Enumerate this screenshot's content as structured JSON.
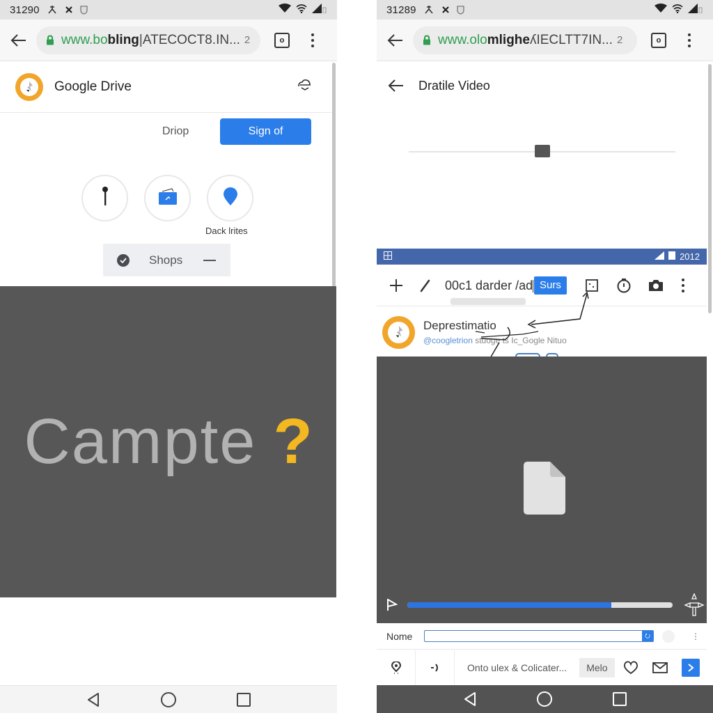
{
  "left": {
    "status": {
      "time": "31290",
      "icons": [
        "fan-icon",
        "close-icon",
        "shield-icon"
      ],
      "right_icons": [
        "wifi-icon",
        "wifi-icon",
        "signal-icon"
      ]
    },
    "url": {
      "prefix": "www.bo",
      "bold": "bling",
      "rest": "|ATECOCT8.IN...",
      "tab_count": "2",
      "tabs_label": "o"
    },
    "header": {
      "title": "Google Drive",
      "logo": "google-drive-logo",
      "action_icon": "cloud-icon"
    },
    "actions": {
      "drop_label": "Driop",
      "sign_label": "Sign of"
    },
    "round_buttons": [
      {
        "icon": "pin-icon",
        "label": ""
      },
      {
        "icon": "folder-icon",
        "label": ""
      },
      {
        "icon": "location-icon",
        "label": "Dack lrites"
      }
    ],
    "chip": {
      "label": "Shops",
      "icon": "check-circle-icon"
    },
    "hero": {
      "text": "Campte",
      "mark": "?"
    },
    "nav": [
      "back",
      "home",
      "recents"
    ]
  },
  "right": {
    "status": {
      "time": "31289",
      "icons": [
        "fan-icon",
        "close-icon",
        "shield-icon"
      ],
      "right_icons": [
        "wifi-icon",
        "wifi-icon",
        "signal-icon"
      ]
    },
    "url": {
      "prefix": "www.olo",
      "bold": "mlighe",
      "rest": "ʎIECLTT7IN...",
      "tab_count": "2",
      "tabs_label": "o"
    },
    "header": {
      "title": "Dratile Video"
    },
    "slider": {
      "value": 0.5
    },
    "bluebar": {
      "year": "2012"
    },
    "toolbar": {
      "field_value": "00c1 darder /ad",
      "button_label": "Surs"
    },
    "profile": {
      "name": "Deprestimatio",
      "handle": "@coogletrion",
      "handle_rest": " stuoge ts Ic_Gogle Nituo"
    },
    "video": {
      "progress": 0.77
    },
    "name_row": {
      "label": "Nome",
      "value": "",
      "addon": "⭮"
    },
    "action_row": {
      "text": "Onto ulex & Colicater...",
      "button_label": "Melo"
    },
    "nav": [
      "back",
      "home",
      "recents"
    ]
  },
  "colors": {
    "accent": "#2b7de9",
    "logo_orange": "#f1a52a",
    "hero_bg": "#575757",
    "hero_mark": "#f2b721",
    "bluebar": "#4466aa"
  }
}
